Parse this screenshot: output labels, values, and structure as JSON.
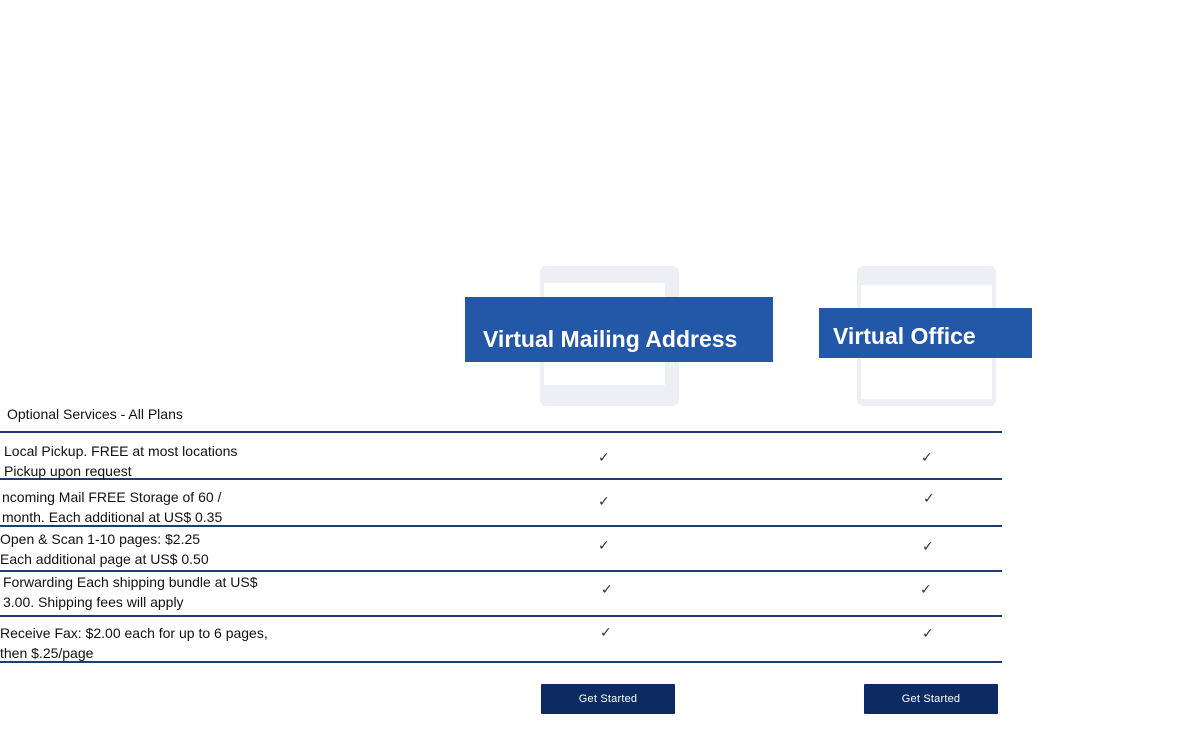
{
  "plans": [
    {
      "name": "Virtual Mailing Address",
      "cta": "Get Started"
    },
    {
      "name": "Virtual Office",
      "cta": "Get Started"
    }
  ],
  "section_title": "Optional Services - All Plans",
  "rows": [
    {
      "line1": "Local Pickup. FREE at most locations",
      "line2": "Pickup upon request",
      "plan1": "✓",
      "plan2": "✓"
    },
    {
      "line1": "ncoming Mail FREE Storage of 60 /",
      "line2": "month. Each additional at US$ 0.35",
      "plan1": "✓",
      "plan2": "✓"
    },
    {
      "line1": "Open & Scan 1-10 pages: $2.25",
      "line2": "Each additional page at US$ 0.50",
      "plan1": "✓",
      "plan2": "✓"
    },
    {
      "line1": "Forwarding Each shipping bundle at US$",
      "line2": "3.00. Shipping fees will apply",
      "plan1": "✓",
      "plan2": "✓"
    },
    {
      "line1": "Receive Fax: $2.00 each for up to 6 pages,",
      "line2": "then $.25/page",
      "plan1": "✓",
      "plan2": "✓"
    }
  ],
  "colors": {
    "banner": "#2357a8",
    "button": "#0d2b63",
    "divider": "#1f3e6e",
    "frame": "#eeeff5"
  }
}
